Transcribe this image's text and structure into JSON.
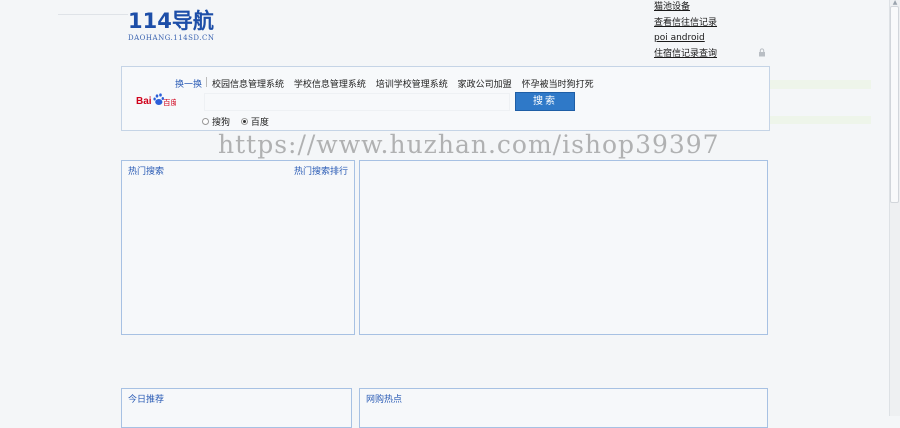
{
  "logo": {
    "main": "114导航",
    "sub": "DAOHANG.114SD.CN"
  },
  "top_links": [
    "猫池设备",
    "查看信往信记录",
    "poi android",
    "住宿信记录查询"
  ],
  "search": {
    "swap_label": "换一换",
    "hot_links": [
      "校园信息管理系统",
      "学校信息管理系统",
      "培训学校管理系统",
      "家政公司加盟",
      "怀孕被当时狗打死"
    ],
    "input_value": "",
    "button_label": "搜索",
    "engines": [
      {
        "label": "搜狗",
        "selected": false
      },
      {
        "label": "百度",
        "selected": true
      }
    ],
    "logo_text": "Bai百度"
  },
  "watermark": "https://www.huzhan.com/ishop39397",
  "panels": {
    "hot_search": {
      "title": "热门搜索",
      "link": "热门搜索排行"
    },
    "today": {
      "title": "今日推荐"
    },
    "web_hot": {
      "title": "网购热点"
    }
  },
  "colors": {
    "accent": "#2f79c8",
    "panel_border": "#a7c1e3",
    "link_blue": "#2a5bb5"
  }
}
